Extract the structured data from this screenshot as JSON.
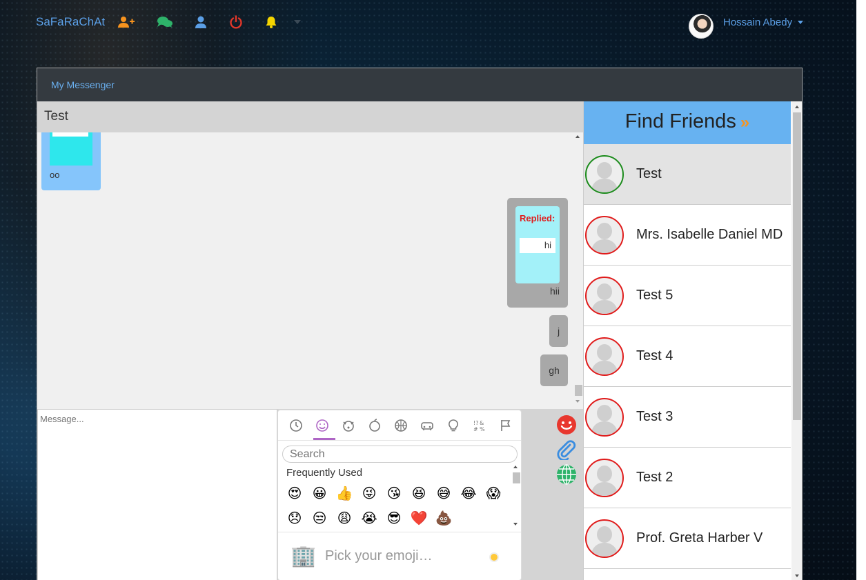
{
  "navbar": {
    "brand": "SaFaRaChAt",
    "icons": [
      "add-user-icon",
      "chats-icon",
      "profile-icon",
      "power-icon",
      "bell-icon"
    ],
    "user_name": "Hossain Abedy"
  },
  "card": {
    "header": "My Messenger"
  },
  "chat": {
    "title": "Test",
    "incoming_text": "oo",
    "reply": {
      "label": "Replied:",
      "quoted": "hi",
      "text": "hii"
    },
    "outgoing": [
      "j",
      "gh"
    ]
  },
  "composer": {
    "placeholder": "Message..."
  },
  "emoji_picker": {
    "tabs": [
      "recent-icon",
      "smileys-icon",
      "animals-icon",
      "food-icon",
      "activity-icon",
      "travel-icon",
      "objects-icon",
      "symbols-icon",
      "flags-icon"
    ],
    "search_placeholder": "Search",
    "section": "Frequently Used",
    "emojis": [
      "😍",
      "😀",
      "👍",
      "😜",
      "😘",
      "😆",
      "😅",
      "😂",
      "😱",
      "😞",
      "😒",
      "😩",
      "😭",
      "😎",
      "❤️",
      "💩"
    ],
    "preview_icon": "🏢",
    "preview_text": "Pick your emoji…",
    "colors": {
      "active_tab": "#ae65c5",
      "skin_tone": "#ffc93a"
    }
  },
  "tools": [
    "smiley-icon",
    "paperclip-icon",
    "globe-icon"
  ],
  "friends": {
    "header": "Find Friends",
    "header_arrows": "»",
    "list": [
      {
        "name": "Test",
        "online": true
      },
      {
        "name": "Mrs. Isabelle Daniel MD",
        "online": false
      },
      {
        "name": "Test 5",
        "online": false
      },
      {
        "name": "Test 4",
        "online": false
      },
      {
        "name": "Test 3",
        "online": false
      },
      {
        "name": "Test 2",
        "online": false
      },
      {
        "name": "Prof. Greta Harber V",
        "online": false
      }
    ]
  },
  "colors": {
    "brand": "#5b9fe6",
    "header_bg": "#343a40",
    "find_friends_bg": "#67b2f1",
    "online": "#1b8b1b",
    "offline": "#e01a1a"
  }
}
